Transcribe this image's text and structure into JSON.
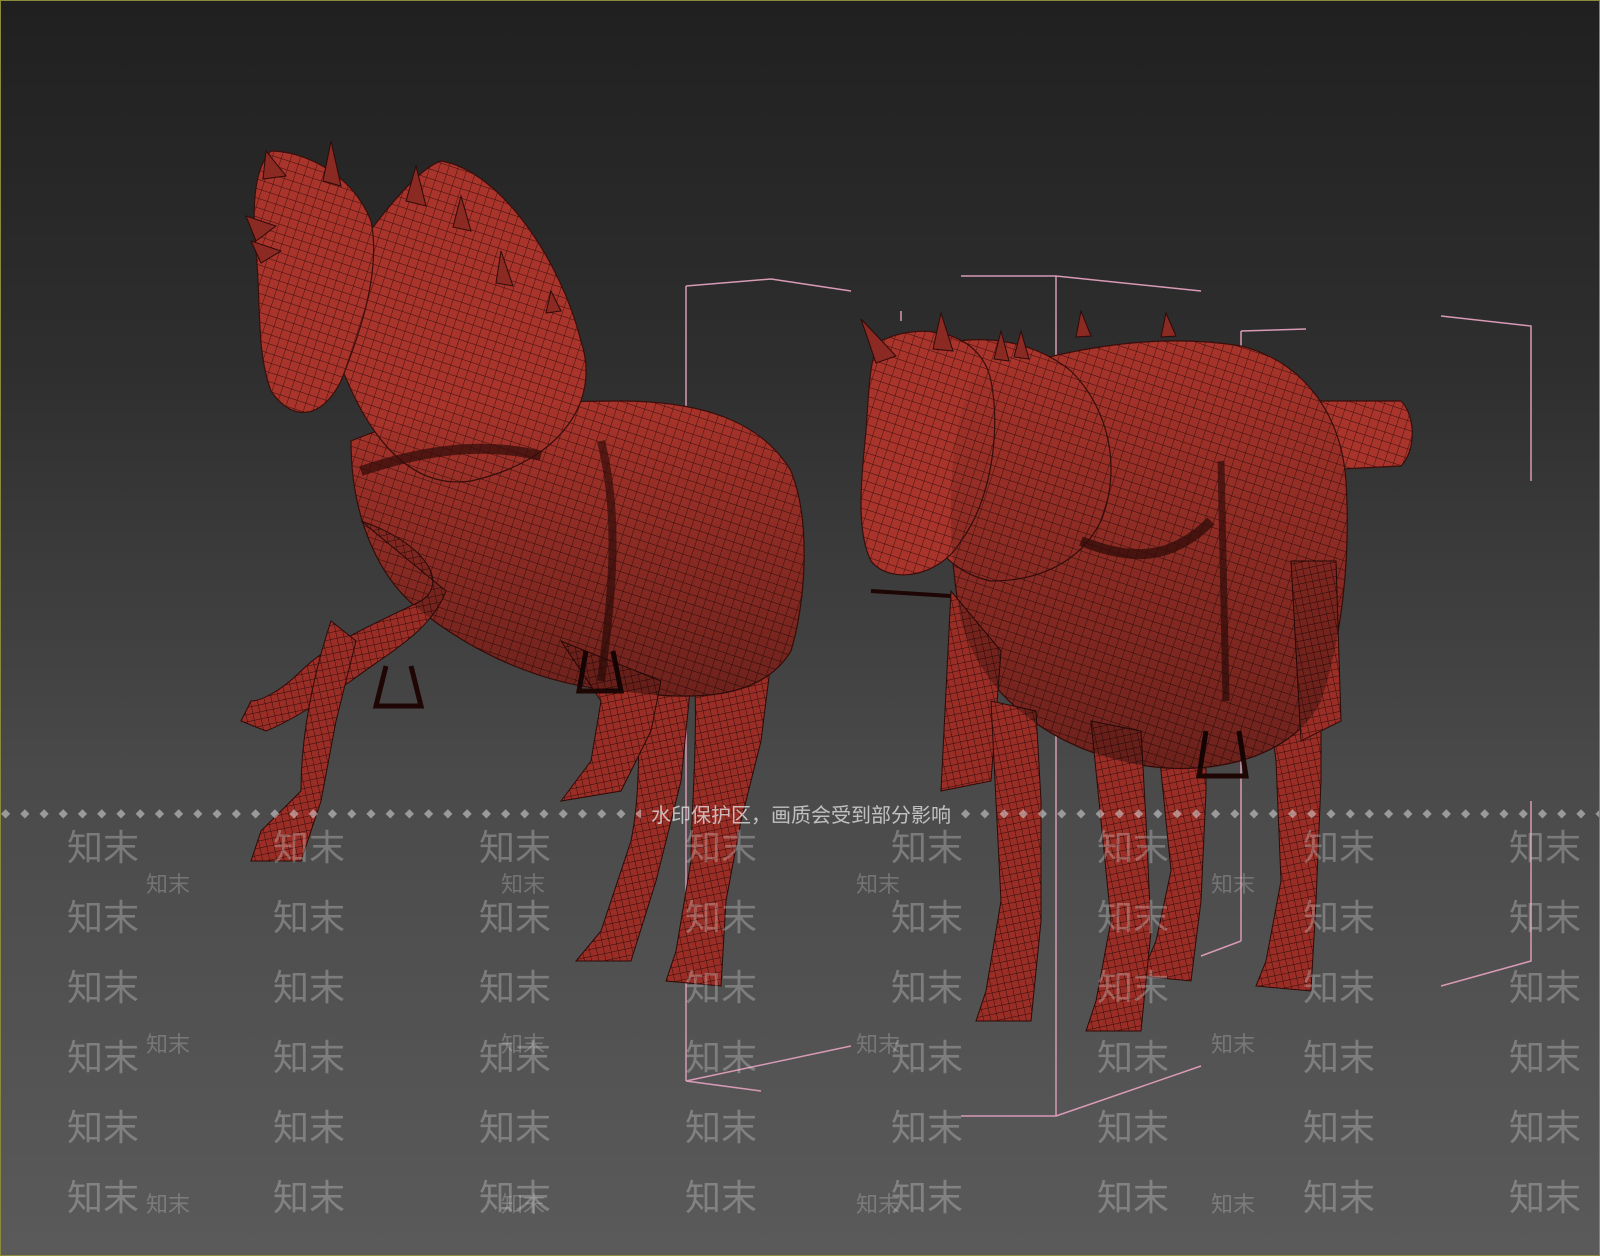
{
  "viewport": {
    "background_top": "#202020",
    "background_bottom": "#5a5a5a",
    "border_color": "#8a8a3a"
  },
  "models": [
    {
      "name": "horse-rearing",
      "mesh_color": "#a8342b",
      "wire_color": "#3a0e0b"
    },
    {
      "name": "horse-standing",
      "mesh_color": "#a8342b",
      "wire_color": "#3a0e0b"
    }
  ],
  "bounding_box_color": "#d89ab5",
  "watermark": {
    "notice": "水印保护区，画质会受到部分影响",
    "brand": "知末",
    "dot": "◆"
  }
}
